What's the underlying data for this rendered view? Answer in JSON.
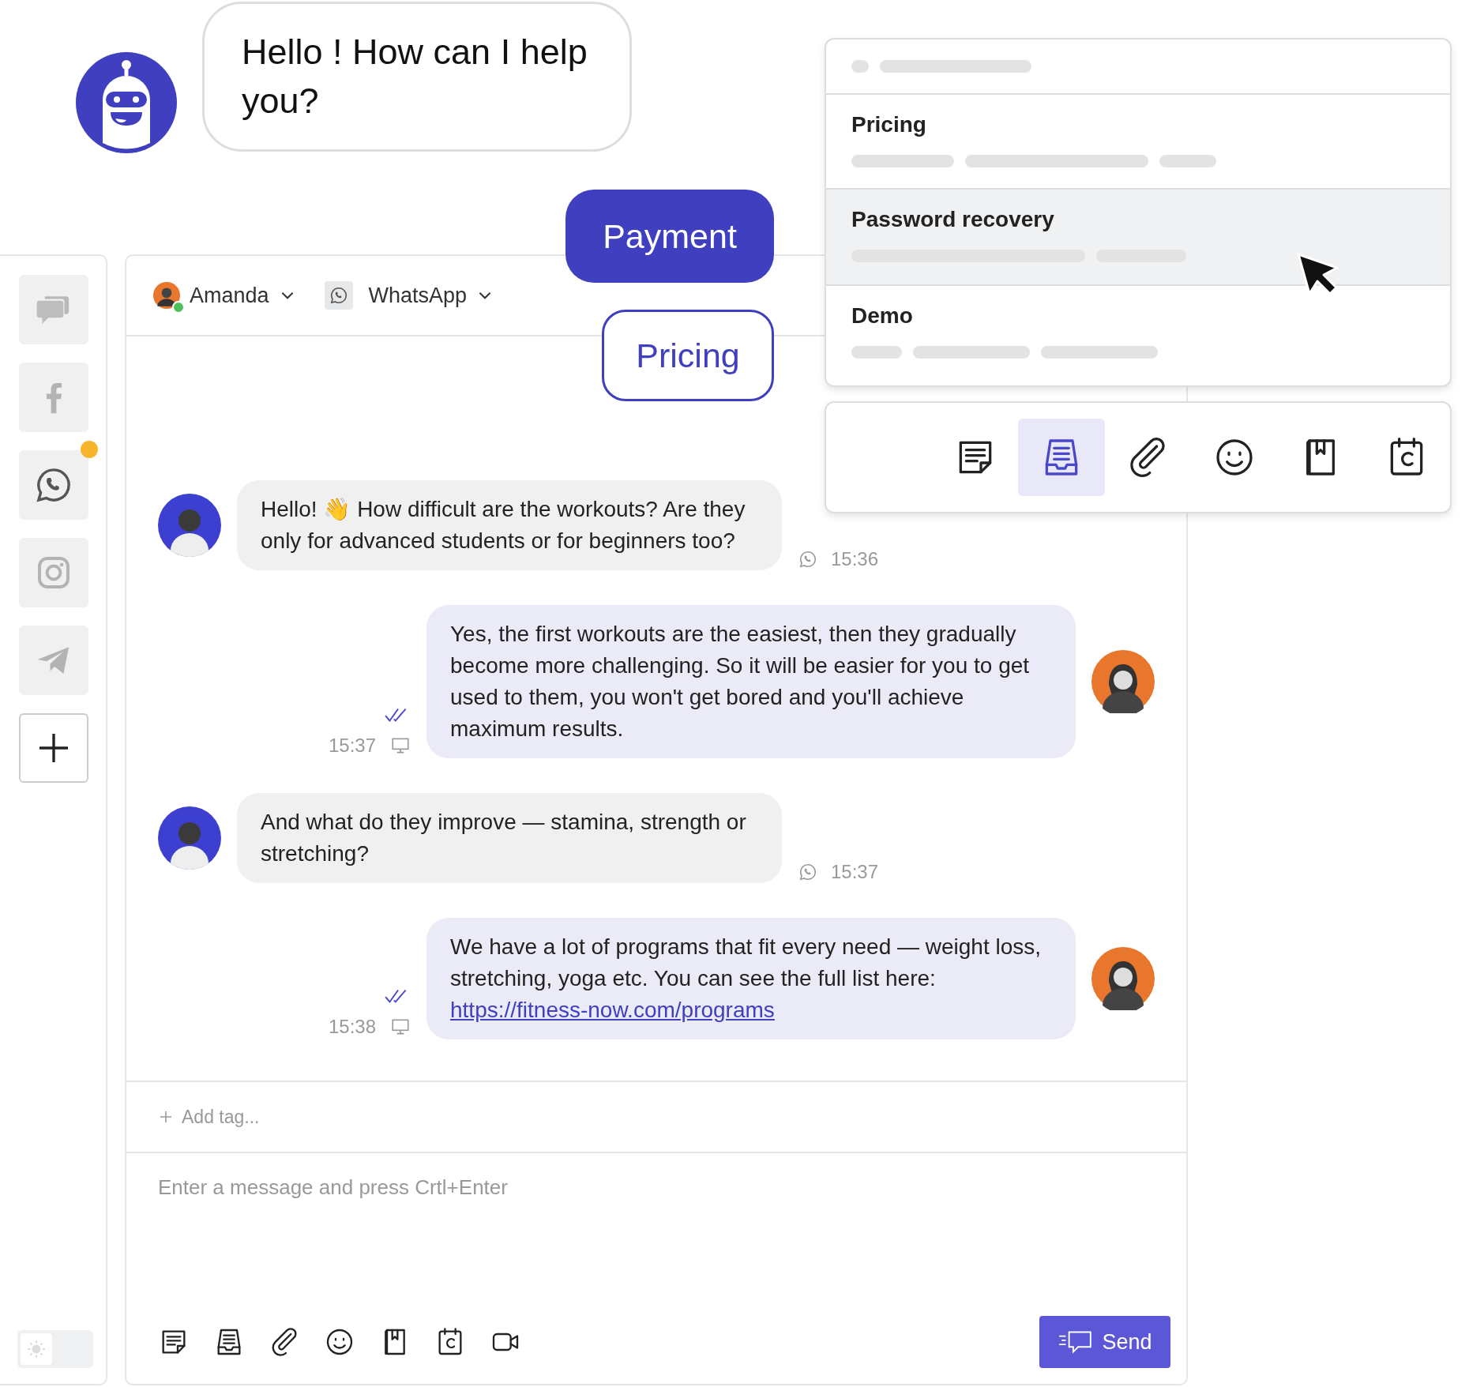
{
  "bot": {
    "message": "Hello ! How can I help you?"
  },
  "quick_replies": [
    {
      "label": "Payment",
      "kind": "filled"
    },
    {
      "label": "Pricing",
      "kind": "outline"
    }
  ],
  "sidebar": {
    "channels": [
      {
        "kind": "chats",
        "notification": false
      },
      {
        "kind": "facebook",
        "notification": false
      },
      {
        "kind": "whatsapp",
        "notification": true
      },
      {
        "kind": "instagram",
        "notification": false
      },
      {
        "kind": "telegram",
        "notification": false
      },
      {
        "kind": "add",
        "notification": false
      }
    ],
    "theme_toggle": {
      "on": false
    }
  },
  "chat": {
    "agent": {
      "name": "Amanda",
      "online": true
    },
    "channel": {
      "name": "WhatsApp"
    },
    "messages": [
      {
        "kind": "incoming",
        "text": "Hello! 👋 How difficult are the workouts? Are they only for advanced students or for beginners too?",
        "time": "15:36"
      },
      {
        "kind": "outgoing",
        "text": "Yes, the first workouts are the easiest, then they gradually become more challenging. So it will be easier for you to get used to them, you won't get bored and you'll achieve maximum results.",
        "time": "15:37",
        "read": true
      },
      {
        "kind": "incoming",
        "text": "And what do they improve — stamina, strength or stretching?",
        "time": "15:37"
      },
      {
        "kind": "outgoing",
        "text": "We have a lot of programs that fit every need — weight loss, stretching, yoga etc. You can see the full list here:",
        "link": "https://fitness-now.com/programs",
        "time": "15:38",
        "read": true
      }
    ],
    "tag_button": "Add tag...",
    "composer": {
      "placeholder": "Enter a message and press Crtl+Enter",
      "tools": [
        {
          "kind": "note"
        },
        {
          "kind": "template"
        },
        {
          "kind": "attach"
        },
        {
          "kind": "emoji"
        },
        {
          "kind": "book"
        },
        {
          "kind": "calendar"
        },
        {
          "kind": "video"
        }
      ],
      "send": "Send"
    }
  },
  "templates": {
    "items": [
      {
        "title": "Pricing",
        "selected": false
      },
      {
        "title": "Password recovery",
        "selected": true
      },
      {
        "title": "Demo",
        "selected": false
      }
    ]
  },
  "tool_popup": {
    "tools": [
      {
        "kind": "note",
        "selected": false
      },
      {
        "kind": "template",
        "selected": true
      },
      {
        "kind": "attach",
        "selected": false
      },
      {
        "kind": "emoji",
        "selected": false
      },
      {
        "kind": "book",
        "selected": false
      },
      {
        "kind": "calendar",
        "selected": false
      }
    ]
  }
}
